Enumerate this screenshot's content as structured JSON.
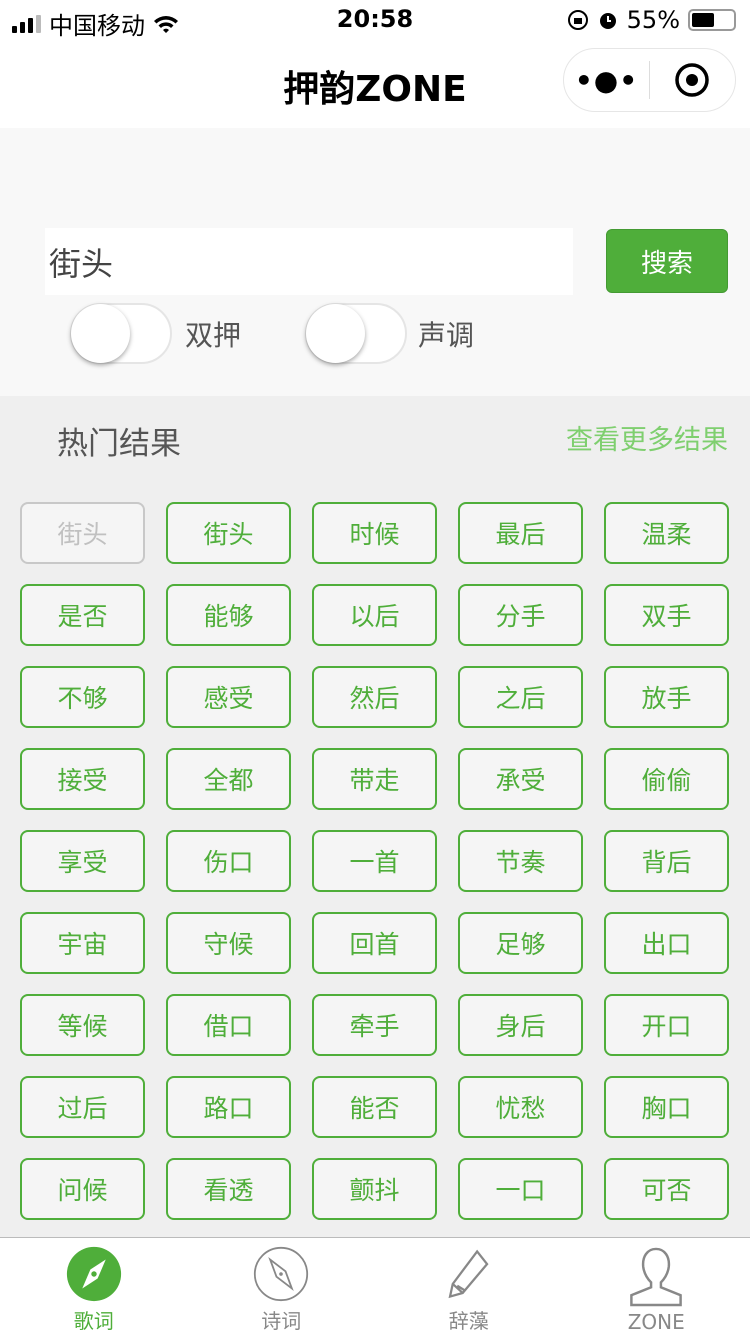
{
  "status_bar": {
    "carrier": "中国移动",
    "time": "20:58",
    "battery": "55%",
    "battery_level": 0.55
  },
  "nav": {
    "title": "押韵ZONE",
    "more": "•●•"
  },
  "search": {
    "value": "街头",
    "button": "搜索",
    "toggles": [
      {
        "label": "双押",
        "on": false
      },
      {
        "label": "声调",
        "on": false
      }
    ]
  },
  "results": {
    "header": "热门结果",
    "more": "查看更多结果",
    "items": [
      "街头",
      "街头",
      "时候",
      "最后",
      "温柔",
      "是否",
      "能够",
      "以后",
      "分手",
      "双手",
      "不够",
      "感受",
      "然后",
      "之后",
      "放手",
      "接受",
      "全都",
      "带走",
      "承受",
      "偷偷",
      "享受",
      "伤口",
      "一首",
      "节奏",
      "背后",
      "宇宙",
      "守候",
      "回首",
      "足够",
      "出口",
      "等候",
      "借口",
      "牵手",
      "身后",
      "开口",
      "过后",
      "路口",
      "能否",
      "忧愁",
      "胸口",
      "问候",
      "看透",
      "颤抖",
      "一口",
      "可否"
    ]
  },
  "tabbar": {
    "active_color": "#4fae3a",
    "tabs": [
      {
        "label": "歌词",
        "icon": "compass-icon",
        "active": true
      },
      {
        "label": "诗词",
        "icon": "compass-outline-icon"
      },
      {
        "label": "辞藻",
        "icon": "pencil-icon"
      },
      {
        "label": "ZONE",
        "icon": "user-icon"
      }
    ]
  }
}
